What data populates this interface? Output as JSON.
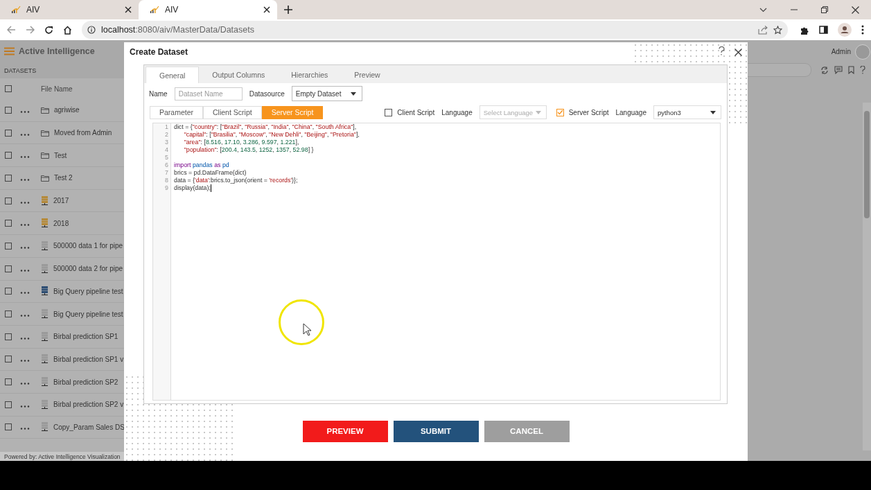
{
  "browser": {
    "tabs": [
      {
        "title": "AIV",
        "selected": false
      },
      {
        "title": "AIV",
        "selected": true
      }
    ],
    "url": {
      "host": "localhost",
      "path": ":8080/aiv/MasterData/Datasets"
    }
  },
  "app": {
    "brand": "Active Intelligence",
    "section": "DATASETS",
    "column": "File Name",
    "all_checked": false,
    "rows": [
      {
        "name": "agriwise",
        "kind": "folder",
        "checked": false
      },
      {
        "name": "Moved from Admin",
        "kind": "folder",
        "checked": false
      },
      {
        "name": "Test",
        "kind": "folder",
        "checked": false
      },
      {
        "name": "Test 2",
        "kind": "folder",
        "checked": false
      },
      {
        "name": "2017",
        "kind": "server",
        "color": "#b58a3a",
        "checked": false
      },
      {
        "name": "2018",
        "kind": "server",
        "color": "#b58a3a",
        "checked": false
      },
      {
        "name": "500000 data 1 for pipe",
        "kind": "server",
        "color": "#9a9a9a",
        "checked": false
      },
      {
        "name": "500000 data 2 for pipe",
        "kind": "server",
        "color": "#9a9a9a",
        "checked": false
      },
      {
        "name": "Big Query pipeline test",
        "kind": "server",
        "color": "#2f4f74",
        "checked": false
      },
      {
        "name": "Big Query pipeline test",
        "kind": "server",
        "color": "#9a9a9a",
        "checked": false
      },
      {
        "name": "Birbal prediction SP1",
        "kind": "server",
        "color": "#9a9a9a",
        "checked": false
      },
      {
        "name": "Birbal prediction SP1 v",
        "kind": "server",
        "color": "#9a9a9a",
        "checked": false
      },
      {
        "name": "Birbal prediction SP2",
        "kind": "server",
        "color": "#9a9a9a",
        "checked": false
      },
      {
        "name": "Birbal prediction SP2 v",
        "kind": "server",
        "color": "#9a9a9a",
        "checked": false
      },
      {
        "name": "Copy_Param Sales DS",
        "kind": "server",
        "color": "#9a9a9a",
        "checked": false
      }
    ],
    "footer": "Powered by: Active Intelligence Visualization",
    "user": "Admin"
  },
  "modal": {
    "title": "Create Dataset",
    "tabs": [
      {
        "label": "General",
        "selected": true
      },
      {
        "label": "Output Columns",
        "selected": false
      },
      {
        "label": "Hierarchies",
        "selected": false
      },
      {
        "label": "Preview",
        "selected": false
      }
    ],
    "name_label": "Name",
    "name_placeholder": "Dataset Name",
    "datasource_label": "Datasource",
    "datasource": "Empty Dataset",
    "script_tabs": [
      {
        "label": "Parameter",
        "selected": false
      },
      {
        "label": "Client Script",
        "selected": false
      },
      {
        "label": "Server Script",
        "selected": true
      }
    ],
    "client_script": {
      "label": "Client Script",
      "checked": false,
      "language_label": "Language",
      "language_placeholder": "Select Language",
      "disabled": true
    },
    "server_script": {
      "label": "Server Script",
      "checked": true,
      "language_label": "Language",
      "language": "python3",
      "disabled": false
    },
    "lines": [
      {
        "number": "1",
        "caret": false,
        "segments": [
          {
            "kind": "plain",
            "text": "dict = {"
          },
          {
            "kind": "string",
            "text": "\"country\""
          },
          {
            "kind": "plain",
            "text": ": ["
          },
          {
            "kind": "string",
            "text": "\"Brazil\""
          },
          {
            "kind": "plain",
            "text": ", "
          },
          {
            "kind": "string",
            "text": "\"Russia\""
          },
          {
            "kind": "plain",
            "text": ", "
          },
          {
            "kind": "string",
            "text": "\"India\""
          },
          {
            "kind": "plain",
            "text": ", "
          },
          {
            "kind": "string",
            "text": "\"China\""
          },
          {
            "kind": "plain",
            "text": ", "
          },
          {
            "kind": "string",
            "text": "\"South Africa\""
          },
          {
            "kind": "plain",
            "text": "],"
          }
        ]
      },
      {
        "number": "2",
        "caret": false,
        "segments": [
          {
            "kind": "string",
            "text": "      \"capital\""
          },
          {
            "kind": "plain",
            "text": ": ["
          },
          {
            "kind": "string",
            "text": "\"Brasilia\""
          },
          {
            "kind": "plain",
            "text": ", "
          },
          {
            "kind": "string",
            "text": "\"Moscow\""
          },
          {
            "kind": "plain",
            "text": ", "
          },
          {
            "kind": "string",
            "text": "\"New Dehli\""
          },
          {
            "kind": "plain",
            "text": ", "
          },
          {
            "kind": "string",
            "text": "\"Beijing\""
          },
          {
            "kind": "plain",
            "text": ", "
          },
          {
            "kind": "string",
            "text": "\"Pretoria\""
          },
          {
            "kind": "plain",
            "text": "],"
          }
        ]
      },
      {
        "number": "3",
        "caret": false,
        "segments": [
          {
            "kind": "string",
            "text": "      \"area\""
          },
          {
            "kind": "plain",
            "text": ": ["
          },
          {
            "kind": "number",
            "text": "8.516"
          },
          {
            "kind": "plain",
            "text": ", "
          },
          {
            "kind": "number",
            "text": "17.10"
          },
          {
            "kind": "plain",
            "text": ", "
          },
          {
            "kind": "number",
            "text": "3.286"
          },
          {
            "kind": "plain",
            "text": ", "
          },
          {
            "kind": "number",
            "text": "9.597"
          },
          {
            "kind": "plain",
            "text": ", "
          },
          {
            "kind": "number",
            "text": "1.221"
          },
          {
            "kind": "plain",
            "text": "],"
          }
        ]
      },
      {
        "number": "4",
        "caret": false,
        "segments": [
          {
            "kind": "string",
            "text": "      \"population\""
          },
          {
            "kind": "plain",
            "text": ": ["
          },
          {
            "kind": "number",
            "text": "200.4"
          },
          {
            "kind": "plain",
            "text": ", "
          },
          {
            "kind": "number",
            "text": "143.5"
          },
          {
            "kind": "plain",
            "text": ", "
          },
          {
            "kind": "number",
            "text": "1252"
          },
          {
            "kind": "plain",
            "text": ", "
          },
          {
            "kind": "number",
            "text": "1357"
          },
          {
            "kind": "plain",
            "text": ", "
          },
          {
            "kind": "number",
            "text": "52.98"
          },
          {
            "kind": "plain",
            "text": "] }"
          }
        ]
      },
      {
        "number": "5",
        "caret": false
      },
      {
        "number": "6",
        "caret": false,
        "segments": [
          {
            "kind": "keyword",
            "text": "import "
          },
          {
            "kind": "name",
            "text": "pandas "
          },
          {
            "kind": "keyword",
            "text": "as "
          },
          {
            "kind": "name",
            "text": "pd"
          }
        ]
      },
      {
        "number": "7",
        "caret": false,
        "segments": [
          {
            "kind": "plain",
            "text": "brics = pd.DataFrame(dict)"
          }
        ]
      },
      {
        "number": "8",
        "caret": false,
        "segments": [
          {
            "kind": "plain",
            "text": "data = {"
          },
          {
            "kind": "string",
            "text": "'data'"
          },
          {
            "kind": "plain",
            "text": ":brics.to_json(orient = "
          },
          {
            "kind": "string",
            "text": "'records'"
          },
          {
            "kind": "plain",
            "text": ")};"
          }
        ]
      },
      {
        "number": "9",
        "caret": true,
        "segments": [
          {
            "kind": "plain",
            "text": "display(data);"
          }
        ]
      }
    ],
    "buttons": [
      {
        "label": "PREVIEW",
        "kind": "danger"
      },
      {
        "label": "SUBMIT",
        "kind": "primary"
      },
      {
        "label": "CANCEL",
        "kind": "neutral"
      }
    ]
  }
}
